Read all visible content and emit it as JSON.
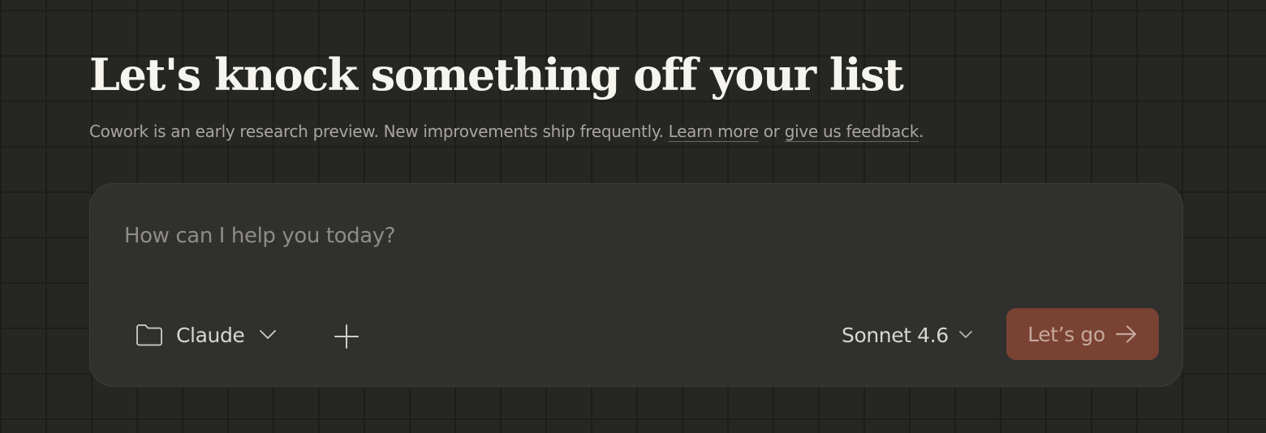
{
  "header": {
    "title": "Let's knock something off your list",
    "subtitle_prefix": "Cowork is an early research preview. New improvements ship frequently. ",
    "learn_more_link": "Learn more",
    "subtitle_connector": " or ",
    "feedback_link": "give us feedback",
    "subtitle_suffix": "."
  },
  "composer": {
    "placeholder": "How can I help you today?",
    "value": "",
    "folder": {
      "icon": "folder-icon",
      "label": "Claude",
      "chevron_icon": "chevron-down-icon"
    },
    "add_button_icon": "plus-icon",
    "model": {
      "label": "Sonnet 4.6",
      "chevron_icon": "chevron-down-icon"
    },
    "submit": {
      "label": "Let’s go",
      "icon": "arrow-right-icon"
    }
  },
  "colors": {
    "background": "#262624",
    "grid_line": "#1d1d1b",
    "composer_background": "#30302e",
    "heading_text": "#f5f4ef",
    "muted_text": "#a9a69e",
    "accent_button": "#7a4233",
    "accent_button_text": "#c4a79c"
  }
}
